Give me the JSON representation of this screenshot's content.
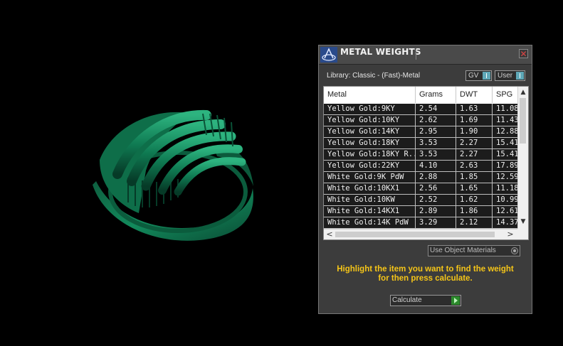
{
  "panel": {
    "title": "METAL WEIGHTS",
    "library": "Library: Classic - (Fast)-Metal",
    "toggles": {
      "gv": "GV",
      "user": "User"
    },
    "columns": [
      "Metal",
      "Grams",
      "DWT",
      "SPG"
    ],
    "rows": [
      {
        "metal": "Yellow Gold:9KY",
        "grams": "2.54",
        "dwt": "1.63",
        "spg": "11.08"
      },
      {
        "metal": "Yellow Gold:10KY",
        "grams": "2.62",
        "dwt": "1.69",
        "spg": "11.43"
      },
      {
        "metal": "Yellow Gold:14KY",
        "grams": "2.95",
        "dwt": "1.90",
        "spg": "12.88"
      },
      {
        "metal": "Yellow Gold:18KY",
        "grams": "3.53",
        "dwt": "2.27",
        "spg": "15.41"
      },
      {
        "metal": "Yellow Gold:18KY R...",
        "grams": "3.53",
        "dwt": "2.27",
        "spg": "15.41"
      },
      {
        "metal": "Yellow Gold:22KY",
        "grams": "4.10",
        "dwt": "2.63",
        "spg": "17.89"
      },
      {
        "metal": "White Gold:9K PdW",
        "grams": "2.88",
        "dwt": "1.85",
        "spg": "12.59"
      },
      {
        "metal": "White Gold:10KX1",
        "grams": "2.56",
        "dwt": "1.65",
        "spg": "11.18"
      },
      {
        "metal": "White Gold:10KW",
        "grams": "2.52",
        "dwt": "1.62",
        "spg": "10.99"
      },
      {
        "metal": "White Gold:14KX1",
        "grams": "2.89",
        "dwt": "1.86",
        "spg": "12.61"
      },
      {
        "metal": "White Gold:14K PdW",
        "grams": "3.29",
        "dwt": "2.12",
        "spg": "14.37"
      }
    ],
    "use_object_materials": "Use Object Materials",
    "instruction_line1": "Highlight the item you want to find the weight",
    "instruction_line2": "for then press calculate.",
    "calculate_label": "Calculate"
  },
  "scroll_icons": {
    "up": "▲",
    "down": "▼",
    "left": "<",
    "right": ">"
  },
  "colors": {
    "ring": "#0f7a52",
    "highlight": "#f5c518",
    "toggle_knob": "#5fa8b8"
  }
}
